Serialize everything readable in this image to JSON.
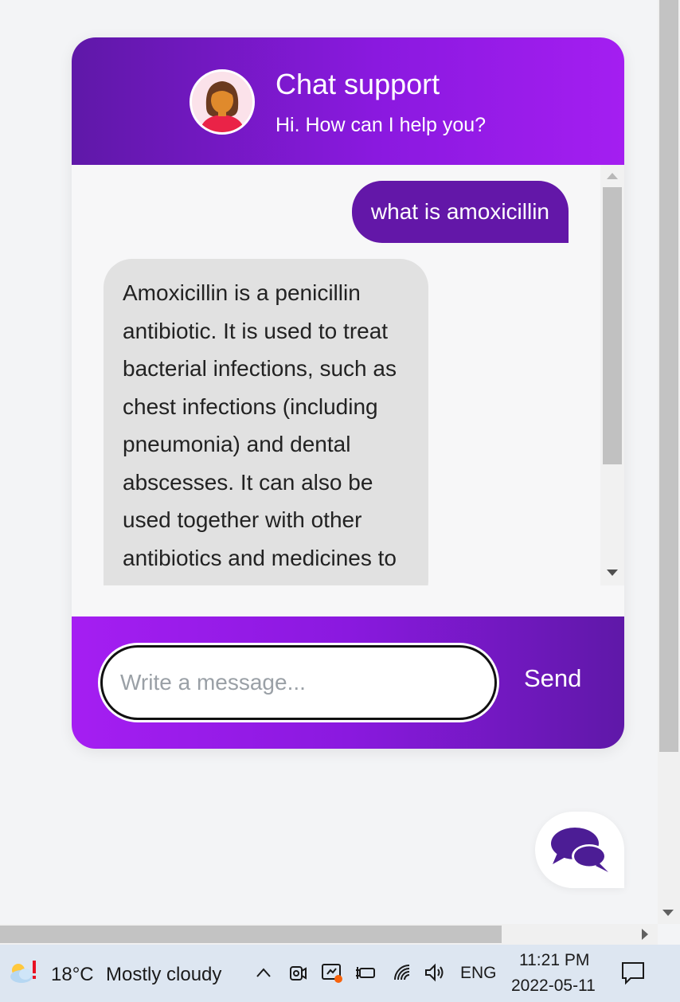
{
  "chat": {
    "header": {
      "title": "Chat support",
      "subtitle": "Hi. How can I help you?",
      "avatar_icon": "woman-avatar-icon"
    },
    "messages": [
      {
        "sender": "user",
        "text": "what is amoxicillin"
      },
      {
        "sender": "bot",
        "text": "Amoxicillin is a penicillin antibiotic. It is used to treat bacterial infections, such as chest infections (including pneumonia) and dental abscesses. It can also be used together with other antibiotics and medicines to treat stomach ulcers."
      }
    ],
    "input": {
      "placeholder": "Write a message...",
      "value": ""
    },
    "send_label": "Send"
  },
  "launcher": {
    "icon": "chat-bubbles-icon"
  },
  "taskbar": {
    "weather": {
      "temperature": "18°C",
      "condition": "Mostly cloudy",
      "icon": "weather-alert-icon"
    },
    "tray_icons": [
      "chevron-up-icon",
      "webcam-icon",
      "meet-now-icon",
      "battery-icon",
      "wifi-icon",
      "volume-icon"
    ],
    "language": "ENG",
    "time": "11:21 PM",
    "date": "2022-05-11",
    "notification_icon": "notification-icon"
  },
  "colors": {
    "header_gradient": [
      "#5f18a8",
      "#a41ef1"
    ],
    "user_bubble": "#6317a8",
    "bot_bubble": "#e1e1e1",
    "taskbar": "#dde6f1"
  }
}
